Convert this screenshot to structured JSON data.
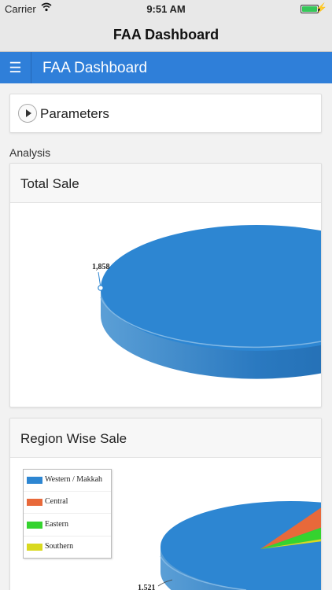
{
  "status_bar": {
    "carrier": "Carrier",
    "time": "9:51 AM"
  },
  "nav_bar": {
    "title": "FAA Dashboard"
  },
  "app_bar": {
    "title": "FAA Dashboard",
    "menu_icon": "hamburger-icon"
  },
  "parameters": {
    "label": "Parameters",
    "icon": "play-icon"
  },
  "analysis": {
    "label": "Analysis"
  },
  "total_sale": {
    "title": "Total Sale"
  },
  "region_sale": {
    "title": "Region Wise Sale"
  },
  "colors": {
    "blue": "#2d86d2",
    "orange": "#e8693a",
    "green": "#35d32f",
    "yellow": "#d9d91f",
    "appbar": "#2f7fd9"
  },
  "chart_data": [
    {
      "type": "pie",
      "title": "Total Sale",
      "slices": [
        {
          "value": 1858
        }
      ],
      "data_labels": [
        "1,858"
      ]
    },
    {
      "type": "pie",
      "title": "Region Wise Sale",
      "legend_position": "top-left",
      "slices": [
        {
          "name": "Western / Makkah",
          "value": 1521
        },
        {
          "name": "Central"
        },
        {
          "name": "Eastern"
        },
        {
          "name": "Southern"
        }
      ],
      "data_labels": [
        "1,521"
      ]
    }
  ]
}
